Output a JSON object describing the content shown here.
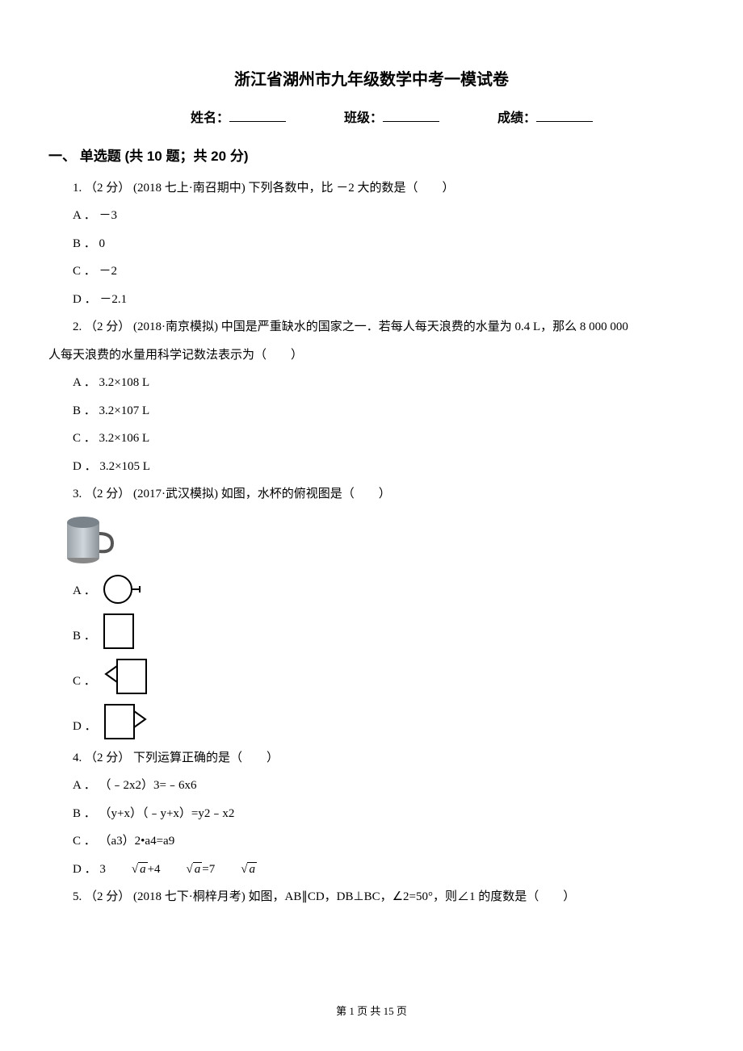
{
  "title": "浙江省湖州市九年级数学中考一模试卷",
  "header": {
    "name_label": "姓名：",
    "class_label": "班级：",
    "score_label": "成绩："
  },
  "section1": {
    "heading": "一、 单选题 (共 10 题；共 20 分)"
  },
  "q1": {
    "stem": "1. （2 分） (2018 七上·南召期中) 下列各数中，比 －2 大的数是（　　）",
    "a": "A ． －3",
    "b": "B ． 0",
    "c": "C ． －2",
    "d": "D ． －2.1"
  },
  "q2": {
    "stem_a": "2. （2 分） (2018·南京模拟) 中国是严重缺水的国家之一．若每人每天浪费的水量为 0.4 L，那么 8 000 000",
    "stem_b": "人每天浪费的水量用科学记数法表示为（　　）",
    "a": "A ． 3.2×108 L",
    "b": "B ． 3.2×107 L",
    "c": "C ． 3.2×106 L",
    "d": "D ． 3.2×105 L"
  },
  "q3": {
    "stem": "3. （2 分） (2017·武汉模拟) 如图，水杯的俯视图是（　　）",
    "a": "A ．",
    "b": "B ．",
    "c": "C ．",
    "d": "D ．"
  },
  "q4": {
    "stem": "4. （2 分） 下列运算正确的是（　　）",
    "a": "A ． （﹣2x2）3=﹣6x6",
    "b": "B ． （y+x）（﹣y+x）=y2﹣x2",
    "c": "C ． （a3）2•a4=a9",
    "d_prefix": "D ． 3",
    "d_mid": "+4",
    "d_eq": "=7",
    "rad": "a"
  },
  "q5": {
    "stem": "5. （2 分） (2018 七下·桐梓月考) 如图，AB∥CD，DB⊥BC，∠2=50°，则∠1 的度数是（　　）"
  },
  "footer": {
    "text": "第 1 页 共 15 页"
  }
}
